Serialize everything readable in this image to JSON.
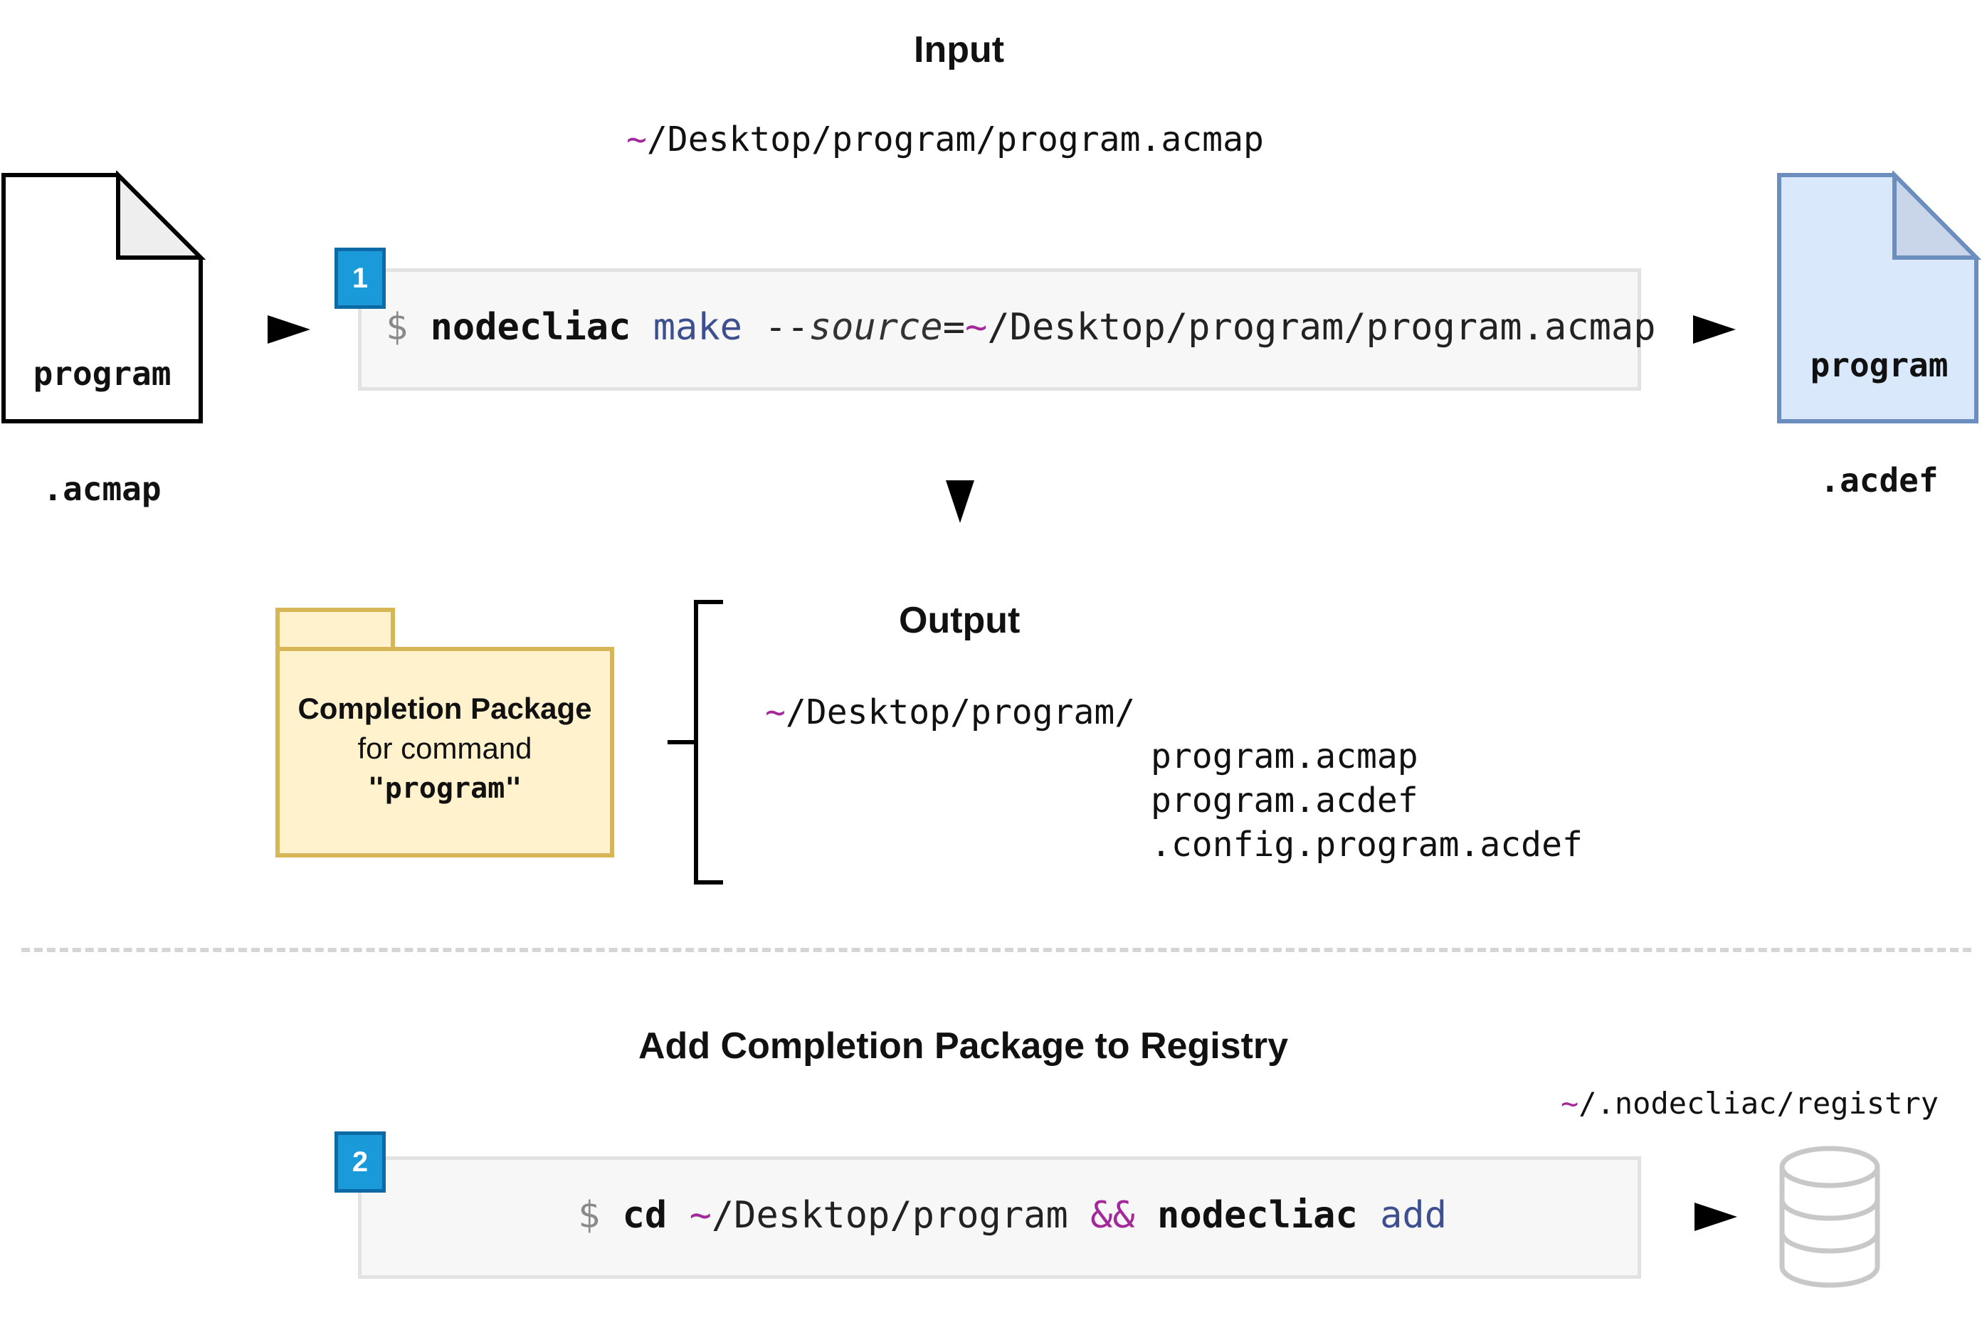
{
  "input": {
    "heading": "Input",
    "path_tilde": "~",
    "path_rest": "/Desktop/program/program.acmap"
  },
  "source_file": {
    "line1": "program",
    "line2": ".acmap"
  },
  "output_file": {
    "line1": "program",
    "line2": ".acdef",
    "fill_color": "#dae8fc",
    "stroke_color": "#6c8ebf"
  },
  "step1": {
    "badge": "1",
    "prompt": "$",
    "command": "nodecliac",
    "subcommand": "make",
    "flag": "--",
    "flag_name": "source",
    "equals": "=",
    "arg_tilde": "~",
    "arg_rest": "/Desktop/program/program.acmap"
  },
  "package": {
    "title": "Completion Package",
    "subtitle": "for command",
    "name": "\"program\"",
    "fill_color": "#fff2cc",
    "stroke_color": "#d6b656"
  },
  "output": {
    "heading": "Output",
    "dir_tilde": "~",
    "dir_rest": "/Desktop/program/",
    "files": [
      "program.acmap",
      "program.acdef",
      ".config.program.acdef"
    ]
  },
  "registry_section": {
    "heading": "Add Completion Package to Registry",
    "registry_tilde": "~",
    "registry_rest": "/.nodecliac/registry"
  },
  "step2": {
    "badge": "2",
    "prompt": "$",
    "cd": "cd",
    "path_tilde": "~",
    "path_rest": "/Desktop/program",
    "and": "&&",
    "command": "nodecliac",
    "subcommand": "add"
  },
  "colors": {
    "badge": "#1b9ad9",
    "tilde": "#a3299a",
    "subcommand": "#3d4f8f",
    "database": "#c8c8c8"
  }
}
